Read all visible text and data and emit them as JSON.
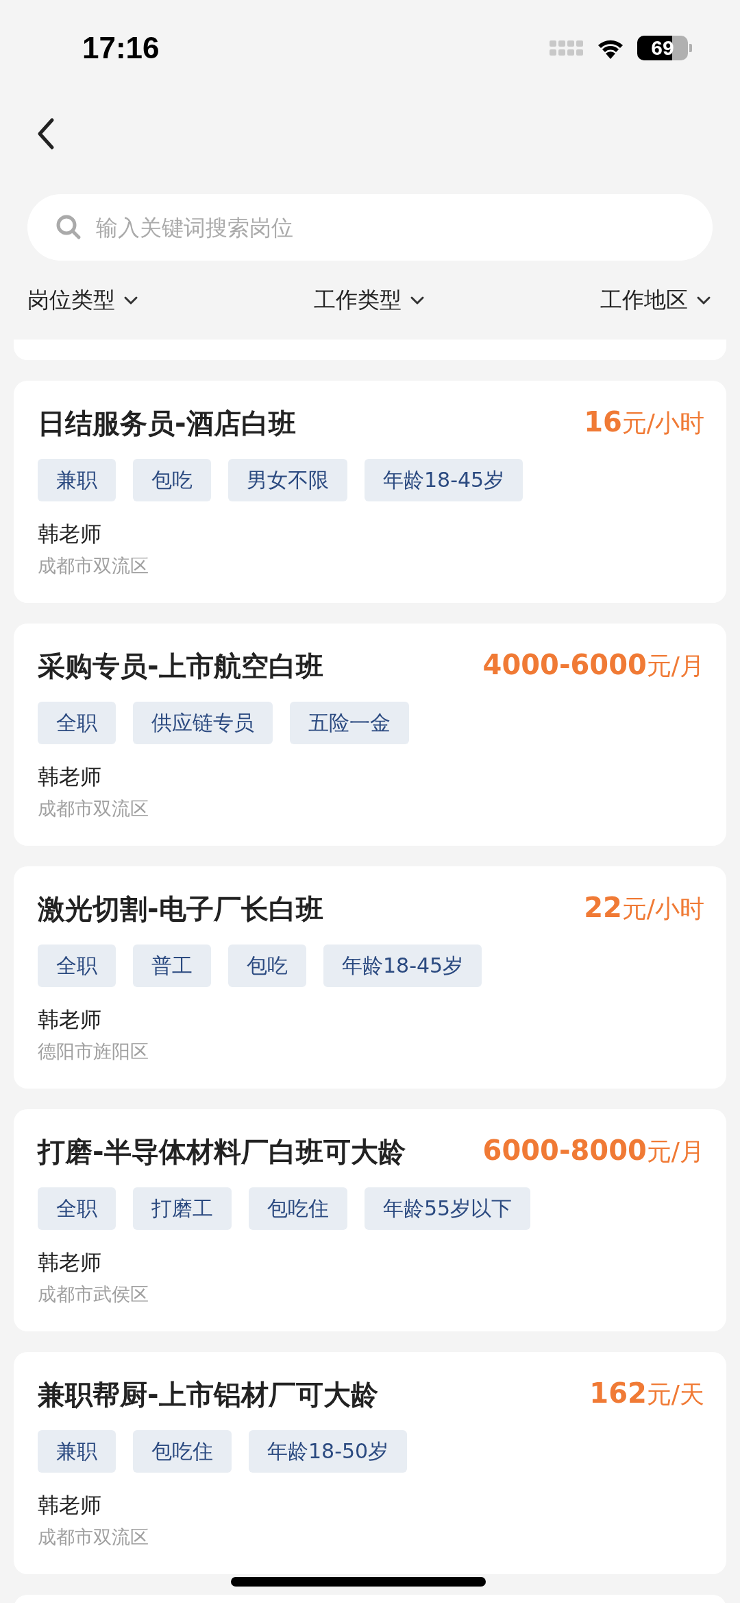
{
  "status_bar": {
    "time": "17:16",
    "battery": "69"
  },
  "search": {
    "placeholder": "输入关键词搜索岗位"
  },
  "filters": [
    "岗位类型",
    "工作类型",
    "工作地区"
  ],
  "jobs": [
    {
      "title": "日结服务员-酒店白班",
      "salary": "**16**元/小时",
      "tags": [
        "兼职",
        "包吃",
        "男女不限",
        "年龄18-45岁"
      ],
      "contact": "韩老师",
      "location": "成都市双流区"
    },
    {
      "title": "采购专员-上市航空白班",
      "salary": "**4000-6000**元/月",
      "tags": [
        "全职",
        "供应链专员",
        "五险一金"
      ],
      "contact": "韩老师",
      "location": "成都市双流区"
    },
    {
      "title": "激光切割-电子厂长白班",
      "salary": "**22**元/小时",
      "tags": [
        "全职",
        "普工",
        "包吃",
        "年龄18-45岁"
      ],
      "contact": "韩老师",
      "location": "德阳市旌阳区"
    },
    {
      "title": "打磨-半导体材料厂白班可大龄",
      "salary": "**6000-8000**元/月",
      "tags": [
        "全职",
        "打磨工",
        "包吃住",
        "年龄55岁以下"
      ],
      "contact": "韩老师",
      "location": "成都市武侯区"
    },
    {
      "title": "兼职帮厨-上市铝材厂可大龄",
      "salary": "**162**元/天",
      "tags": [
        "兼职",
        "包吃住",
        "年龄18-50岁"
      ],
      "contact": "韩老师",
      "location": "成都市双流区"
    }
  ]
}
